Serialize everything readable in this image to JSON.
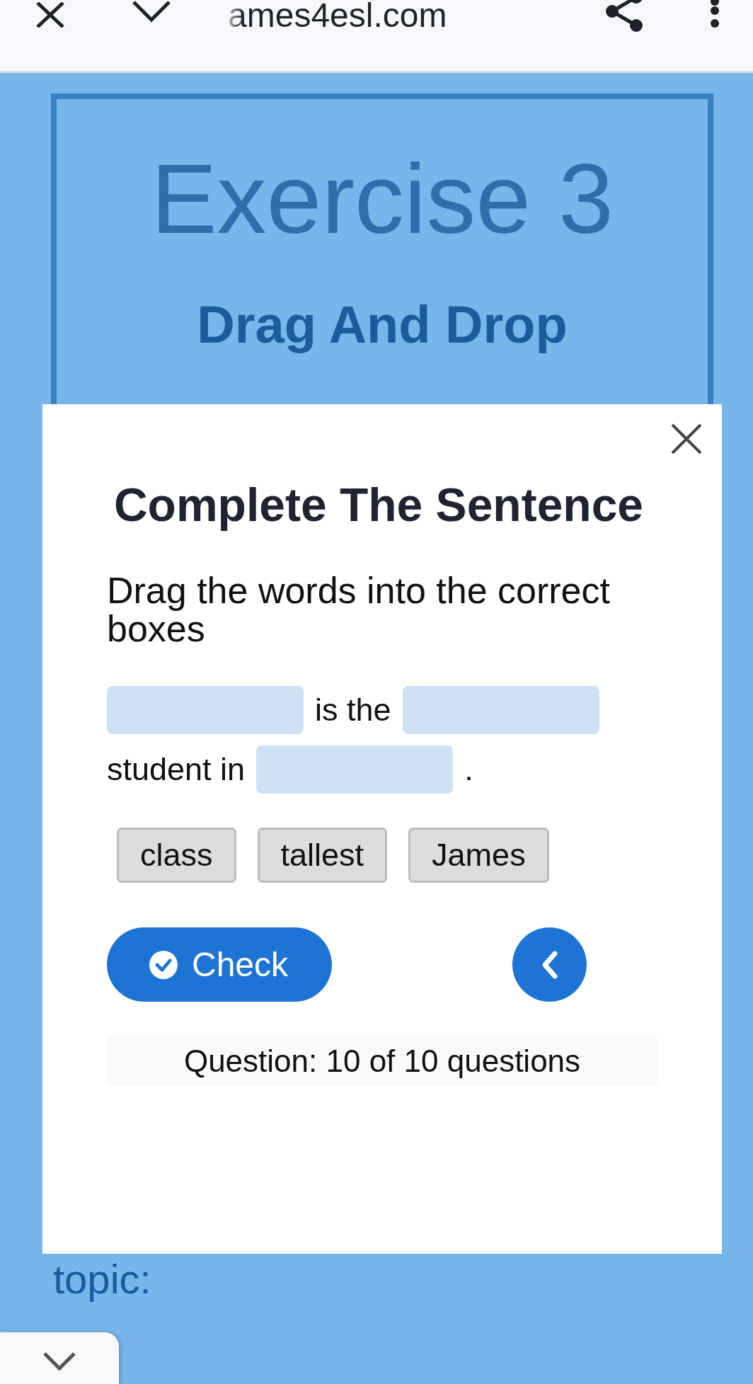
{
  "browser_bar": {
    "url": "ames4esl.com"
  },
  "header": {
    "title": "Exercise 3",
    "subtitle": "Drag And Drop"
  },
  "page_text": "topic:",
  "modal": {
    "title": "Complete The Sentence",
    "instruction": "Drag the words into the correct boxes",
    "sentence": [
      {
        "kind": "blank"
      },
      {
        "kind": "text",
        "text": "is the"
      },
      {
        "kind": "blank"
      },
      {
        "kind": "break"
      },
      {
        "kind": "text",
        "text": "student in"
      },
      {
        "kind": "blank"
      },
      {
        "kind": "text",
        "text": "."
      }
    ],
    "words": [
      "class",
      "tallest",
      "James"
    ],
    "check_button": "Check",
    "progress": "Question: 10 of 10 questions"
  }
}
